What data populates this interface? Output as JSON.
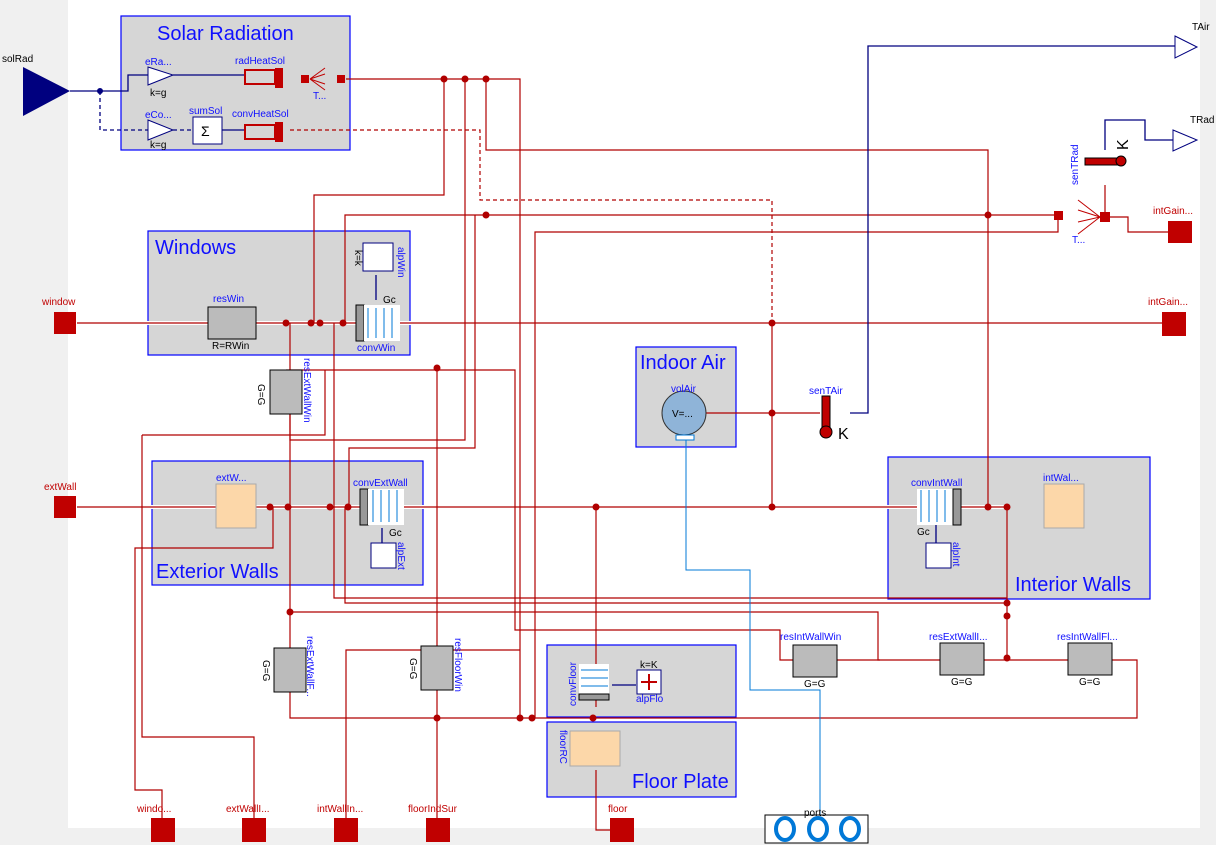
{
  "colors": {
    "heat_port": "#c00000",
    "signal": "#00007f",
    "frame": "#0000ff",
    "fluid": "#0078d7"
  },
  "groups": {
    "solar": "Solar Radiation",
    "windows": "Windows",
    "ext_walls": "Exterior Walls",
    "indoor_air": "Indoor Air",
    "int_walls": "Interior Walls",
    "floor": "Floor Plate"
  },
  "components": {
    "eRad": "eRa...",
    "eRad_k": "k=g",
    "eConv": "eCo...",
    "eConv_k": "k=g",
    "sumSol": "sumSol",
    "sum_symbol": "Σ",
    "radHeatSol": "radHeatSol",
    "convHeatSol": "convHeatSol",
    "thermSplitSol": "T...",
    "resWin": "resWin",
    "resWin_param": "R=RWin",
    "alpWin": "alpWin",
    "alpWin_k": "k=k",
    "convWin": "convWin",
    "gc": "Gc",
    "resExtWallWin": "resExtWallWin",
    "g": "G=G",
    "extWall": "extW...",
    "convExtWall": "convExtWall",
    "alpExt": "alpExt",
    "volAir": "volAir",
    "volAir_param": "V=...",
    "senTAir": "senTAir",
    "unit_k": "K",
    "senTRad": "senTRad",
    "thermSplitRad": "T...",
    "convIntWall": "convIntWall",
    "intWall": "intWal...",
    "alpInt": "alpInt",
    "resIntWallWin": "resIntWallWin",
    "resExtWallInt": "resExtWallI...",
    "resIntWallFloor": "resIntWallFl...",
    "resExtWallFloor": "resExtWallF...",
    "resFloorWin": "resFloorWin",
    "convFloor": "convFloor",
    "alpFlo": "alpFlo",
    "alpFlo_k": "k=K",
    "floorRC": "floorRC"
  },
  "connectors": {
    "solRad": "solRad",
    "TAir": "TAir",
    "TRad": "TRad",
    "intGainsRad": "intGain...",
    "intGainsConv": "intGain...",
    "window": "window",
    "extWall": "extWall",
    "windowIndSur": "windo...",
    "extWallIndSur": "extWallI...",
    "intWallIndSur": "intWallIn...",
    "floorIndSur": "floorIndSur",
    "floor": "floor",
    "ports": "ports"
  }
}
